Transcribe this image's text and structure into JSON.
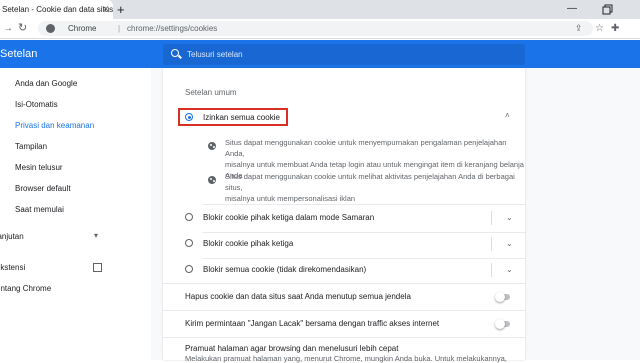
{
  "tab": {
    "title": "Setelan - Cookie dan data situs l",
    "close": "✕",
    "new_tab": "+"
  },
  "window": {
    "minimize": "—"
  },
  "omnibox": {
    "chrome_label": "Chrome",
    "separator": "|",
    "url": "chrome://settings/cookies"
  },
  "header": {
    "title": "Setelan"
  },
  "search": {
    "placeholder": "Telusuri setelan"
  },
  "sidebar": {
    "items": [
      {
        "label": "Anda dan Google"
      },
      {
        "label": "Isi-Otomatis"
      },
      {
        "label": "Privasi dan keamanan"
      },
      {
        "label": "Tampilan"
      },
      {
        "label": "Mesin telusur"
      },
      {
        "label": "Browser default"
      },
      {
        "label": "Saat memulai"
      },
      {
        "label": "Lanjutan"
      },
      {
        "label": "Ekstensi"
      },
      {
        "label": "Tentang Chrome"
      }
    ]
  },
  "cookies": {
    "section_title": "Setelan umum",
    "option_allow": "Izinkan semua cookie",
    "desc1_line1": "Situs dapat menggunakan cookie untuk menyempurnakan pengalaman penjelajahan Anda,",
    "desc1_line2": "misalnya untuk membuat Anda tetap login atau untuk mengingat item di keranjang belanja Anda",
    "desc2_line1": "Situs dapat menggunakan cookie untuk melihat aktivitas penjelajahan Anda di berbagai situs,",
    "desc2_line2": "misalnya untuk mempersonalisasi iklan",
    "option_incognito": "Blokir cookie pihak ketiga dalam mode Samaran",
    "option_third_party": "Blokir cookie pihak ketiga",
    "option_block_all": "Blokir semua cookie (tidak direkomendasikan)",
    "clear_on_exit": "Hapus cookie dan data situs saat Anda menutup semua jendela",
    "do_not_track": "Kirim permintaan \"Jangan Lacak\" bersama dengan traffic akses internet",
    "preload_title": "Pramuat halaman agar browsing dan menelusuri lebih cepat",
    "preload_sub": "Melakukan pramuat halaman yang, menurut Chrome, mungkin Anda buka. Untuk melakukannya,"
  },
  "colors": {
    "accent": "#1a73e8",
    "highlight_border": "#d93025"
  }
}
